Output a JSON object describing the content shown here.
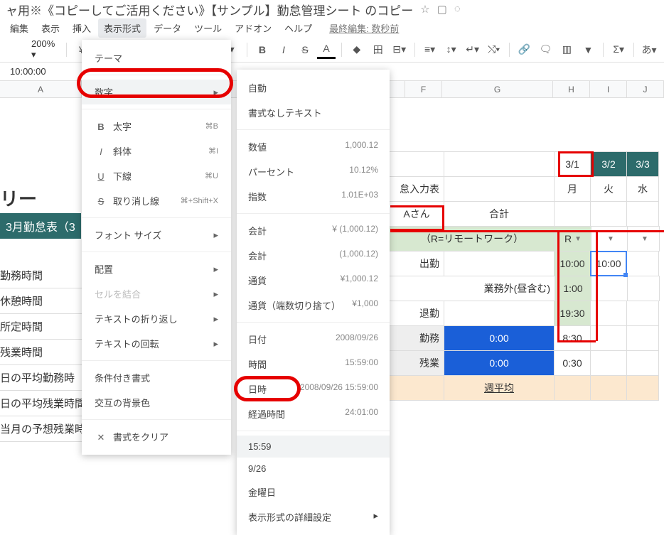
{
  "title": "ャ用※《コピーしてご活用ください》【サンプル】勤怠管理シート のコピー",
  "menubar": [
    "編集",
    "表示",
    "挿入",
    "表示形式",
    "データ",
    "ツール",
    "アドオン",
    "ヘルプ"
  ],
  "lastedit": "最終編集: 数秒前",
  "toolbar": {
    "zoom": "200%",
    "currency": "¥"
  },
  "fxvalue": "10:00:00",
  "columns": [
    "A",
    "F",
    "G",
    "H",
    "I",
    "J"
  ],
  "dropdown1": {
    "theme": "テーマ",
    "number": "数字",
    "bold": "太字",
    "italic": "斜体",
    "underline": "下線",
    "strike": "取り消し線",
    "kbd_bold": "⌘B",
    "kbd_italic": "⌘I",
    "kbd_underline": "⌘U",
    "kbd_strike": "⌘+Shift+X",
    "fontsize": "フォント サイズ",
    "align": "配置",
    "merge": "セルを結合",
    "wrap": "テキストの折り返し",
    "rotate": "テキストの回転",
    "cond": "条件付き書式",
    "alt": "交互の背景色",
    "clear": "書式をクリア"
  },
  "dropdown2": {
    "auto": "自動",
    "plain": "書式なしテキスト",
    "number": "数値",
    "pct": "パーセント",
    "exp": "指数",
    "num_v": "1,000.12",
    "pct_v": "10.12%",
    "exp_v": "1.01E+03",
    "acc": "会計",
    "fin": "会計",
    "cur": "通貨",
    "curr": "通貨（端数切り捨て）",
    "acc_v": "¥ (1,000.12)",
    "fin_v": "(1,000.12)",
    "cur_v": "¥1,000.12",
    "curr_v": "¥1,000",
    "date": "日付",
    "time": "時間",
    "datetime": "日時",
    "dur": "経過時間",
    "date_v": "2008/09/26",
    "time_v": "15:59:00",
    "dt_v": "2008/09/26 15:59:00",
    "dur_v": "24:01:00",
    "t1559": "15:59",
    "d926": "9/26",
    "friday": "金曜日",
    "more": "表示形式の詳細設定"
  },
  "sheet": {
    "bigtitle": "リー",
    "bluebar": "3月勤怠表（3",
    "rows": [
      "勤務時間",
      "休憩時間",
      "所定時間",
      "残業時間",
      "日の平均勤務時",
      "日の平均残業時間）",
      "当月の予想残業時間）"
    ],
    "hdr_asan": "Aさん",
    "hdr_total": "合計",
    "hdr_input": "怠入力表",
    "d31": "3/1",
    "d32": "3/2",
    "d33": "3/3",
    "mon": "月",
    "tue": "火",
    "wed": "水",
    "remote": "（R=リモートワーク）",
    "R": "R",
    "shukkin": "出勤",
    "gyomu": "業務外(昼含む)",
    "taikin": "退勤",
    "kinmu": "勤務",
    "zangyo": "残業",
    "avg": "週平均",
    "t1000": "10:00",
    "t100": "1:00",
    "t1930": "19:30",
    "t000": "0:00",
    "t830": "8:30",
    "t030": "0:30"
  }
}
